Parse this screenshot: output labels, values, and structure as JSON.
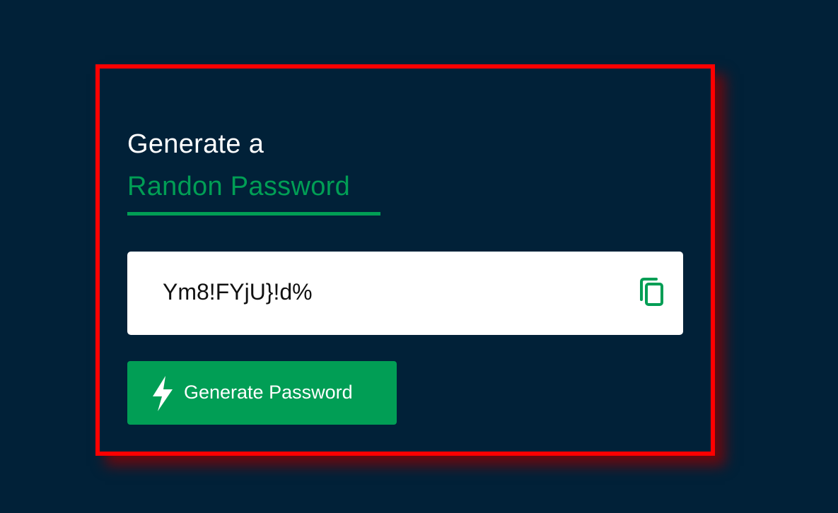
{
  "heading": {
    "line1": "Generate a",
    "line2": "Randon Password"
  },
  "password": {
    "value": "Ym8!FYjU}!d%"
  },
  "icons": {
    "copy": "copy-icon",
    "generate": "lightning-bolt-icon"
  },
  "generate_button": {
    "label": "Generate Password"
  },
  "colors": {
    "background": "#012138",
    "accent": "#019e55",
    "highlight_border": "#ff0000",
    "text_light": "#ffffff",
    "input_background": "#ffffff"
  }
}
